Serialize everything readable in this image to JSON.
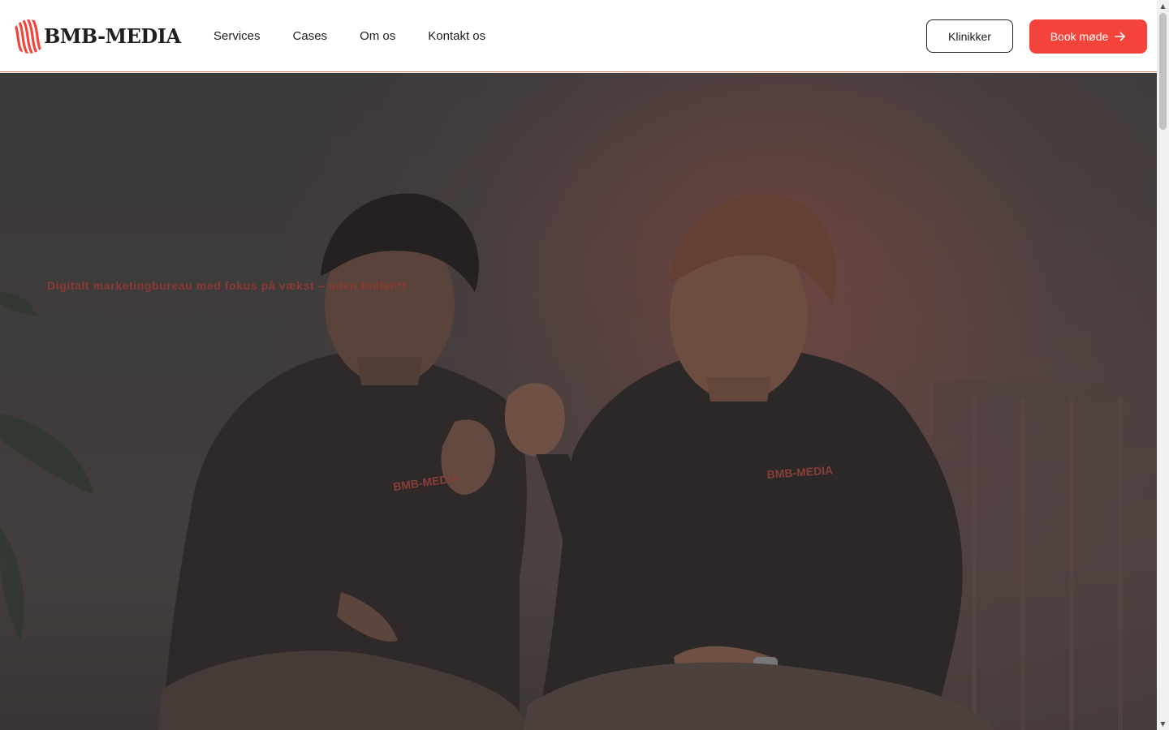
{
  "brand": {
    "name": "BMB-MEDIA",
    "accent_color": "#f4433a",
    "text_color": "#1e1e1e",
    "logo_icon": "stripes-circle-icon"
  },
  "nav": {
    "items": [
      {
        "label": "Services"
      },
      {
        "label": "Cases"
      },
      {
        "label": "Om os"
      },
      {
        "label": "Kontakt os"
      }
    ]
  },
  "actions": {
    "secondary_label": "Klinikker",
    "primary_label": "Book møde",
    "primary_icon": "arrow-right-icon"
  },
  "hero": {
    "tagline": "Digitalt marketingbureau med fokus på vækst – uden bullsh*t",
    "tagline_color": "#8b3a33",
    "image": "two-men-fist-bump-photo",
    "shirt_print": "BMB-MEDIA"
  },
  "scrollbar": {
    "up_icon": "▲",
    "down_icon": "▼"
  }
}
